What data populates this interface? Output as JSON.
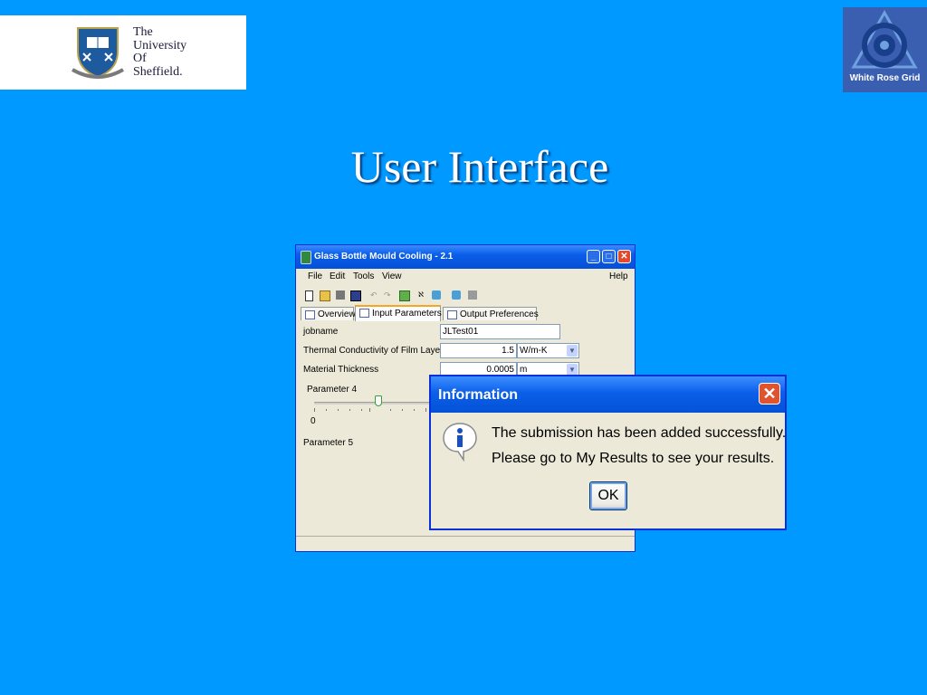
{
  "slide": {
    "title": "User Interface",
    "background_color": "#0099ff"
  },
  "logos": {
    "university": {
      "text": "The\nUniversity\nOf\nSheffield.",
      "icon": "sheffield-crest-icon"
    },
    "white_rose": {
      "text": "White Rose Grid",
      "icon": "white-rose-grid-icon"
    }
  },
  "app_window": {
    "title": "Glass Bottle Mould Cooling - 2.1",
    "menu": [
      "File",
      "Edit",
      "Tools",
      "View"
    ],
    "help": "Help",
    "tabs": [
      "Overview",
      "Input Parameters",
      "Output Preferences"
    ],
    "active_tab": "Input Parameters",
    "form": {
      "jobname_label": "jobname",
      "jobname_value": "JLTest01",
      "thermal_label": "Thermal Conductivity of Film Layer",
      "thermal_value": "1.5",
      "thermal_unit": "W/m-K",
      "thickness_label": "Material Thickness",
      "thickness_value": "0.0005",
      "thickness_unit": "m",
      "param4_label": "Parameter 4",
      "slider_min": "0",
      "param5_label": "Parameter 5"
    }
  },
  "dialog": {
    "title": "Information",
    "line1": "The submission has been added successfully.",
    "line2": "Please go to My Results to see your results.",
    "ok_label": "OK",
    "icon": "info-icon"
  }
}
